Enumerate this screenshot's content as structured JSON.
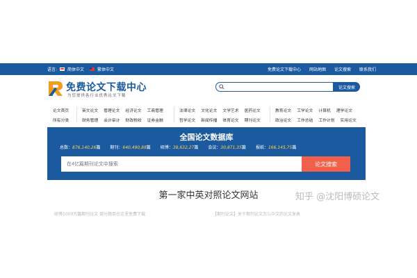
{
  "topbar": {
    "lang_label": "语言:",
    "lang_simplified": "简体中文",
    "lang_traditional": "繁体中文",
    "links": [
      "免费论文下载中心",
      "网站地图",
      "论文搜索",
      "联系我们"
    ]
  },
  "header": {
    "logo_title": "免费论文下载中心",
    "logo_sub": "为您提供各行业优秀论文下载",
    "search_placeholder": "",
    "search_button": "论文搜索"
  },
  "nav": {
    "groups": [
      {
        "row1": [
          "论文首页"
        ],
        "row2": [
          "所有分类"
        ]
      },
      {
        "row1": [
          "英文论文",
          "管理论文",
          "经济论文",
          "工商管理"
        ],
        "row2": [
          "财务管理",
          "会计审计",
          "财政税收",
          "证券金融"
        ]
      },
      {
        "row1": [
          "法律论文",
          "文化论文",
          "文学艺术",
          "医药论文"
        ],
        "row2": [
          "哲学论文",
          "新闻传播",
          "体育论文",
          "期刊论文"
        ]
      },
      {
        "row1": [
          "教育论文",
          "工学论文",
          "计算机",
          "理学论文"
        ],
        "row2": [
          "政治论文",
          "工作总结",
          "工作计划",
          "实用论文"
        ]
      }
    ]
  },
  "banner": {
    "title": "全国论文数据库",
    "stats": [
      {
        "label": "总数：",
        "value": "876,140,26"
      },
      {
        "label": "期刊：",
        "value": "640,490,88"
      },
      {
        "label": "硕博：",
        "value": "38,632,27"
      },
      {
        "label": "会议：",
        "value": "30,871,35"
      },
      {
        "label": "报纸：",
        "value": "166,145,75"
      }
    ],
    "unit": "篇",
    "search_placeholder": "在4亿篇期刊论文中搜索",
    "search_button": "论文搜索"
  },
  "slogan": "第一家中英对照论文网站",
  "watermark": "知乎 @沈阳博硕论文",
  "bottom": {
    "left": "硕博1000万篇期刊论文 部分题目在这里免费下载",
    "right": "【期刊论文】关于期刊论文怎么中文的论文发表"
  },
  "colors": {
    "primary": "#1c5aa0",
    "accent": "#f0604a",
    "stat_value": "#ffd24d"
  }
}
